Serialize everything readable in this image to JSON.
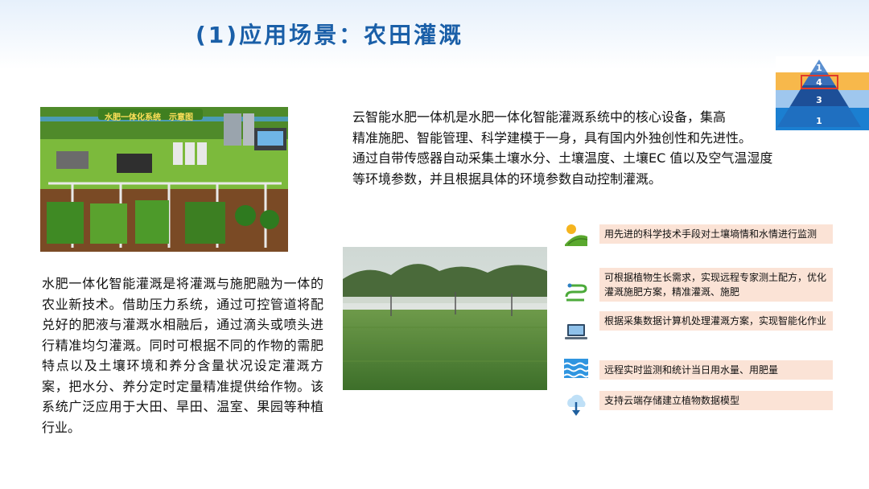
{
  "header": {
    "title": "(1)应用场景：农田灌溉"
  },
  "pyramid": {
    "levels": [
      "1",
      "4",
      "3",
      "1"
    ],
    "highlighted_level": "4"
  },
  "schematic": {
    "caption_left": "水肥一体化系统",
    "caption_right": "示意图"
  },
  "intro_right": {
    "lines": [
      "云智能水肥一体机是水肥一体化智能灌溉系统中的核心设备，集高",
      "精准施肥、智能管理、科学建模于一身，具有国内外独创性和先进性。",
      "通过自带传感器自动采集土壤水分、土壤温度、土壤EC 值以及空气温湿度",
      "等环境参数，并且根据具体的环境参数自动控制灌溉。"
    ]
  },
  "intro_left": {
    "text": "水肥一体化智能灌溉是将灌溉与施肥融为一体的农业新技术。借助压力系统，通过可控管道将配兑好的肥液与灌溉水相融后，通过滴头或喷头进行精准均匀灌溉。同时可根据不同的作物的需肥特点以及土壤环境和养分含量状况设定灌溉方案，把水分、养分定时定量精准提供给作物。该系统广泛应用于大田、旱田、温室、果园等种植行业。"
  },
  "features": [
    {
      "icon": "sun-field-icon",
      "text": "用先进的科学技术手段对土壤墒情和水情进行监测"
    },
    {
      "icon": "hose-icon",
      "text": "可根据植物生长需求，实现远程专家测土配方，优化灌溉施肥方案，精准灌溉、施肥"
    },
    {
      "icon": "laptop-icon",
      "text": "根据采集数据计算机处理灌溉方案，实现智能化作业"
    },
    {
      "icon": "water-icon",
      "text": "远程实时监测和统计当日用水量、用肥量"
    },
    {
      "icon": "cloud-download-icon",
      "text": "支持云端存储建立植物数据模型"
    }
  ],
  "colors": {
    "title": "#1a5fa8",
    "feature_box": "#fbe3d6",
    "pyramid_highlight": "#e03a2a"
  }
}
